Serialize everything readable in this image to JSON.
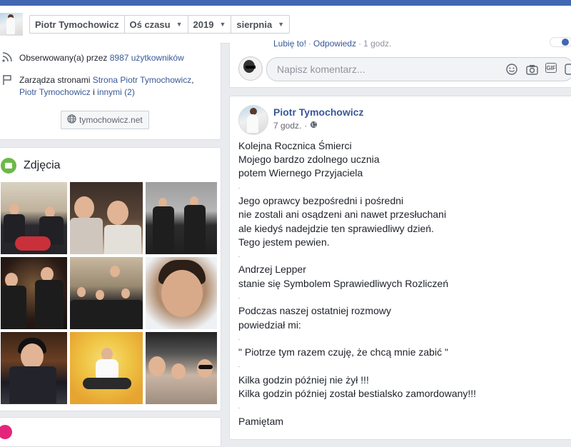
{
  "header": {
    "crumbs": [
      {
        "label": "Piotr Tymochowicz",
        "has_caret": false
      },
      {
        "label": "Oś czasu"
      },
      {
        "label": "2019"
      },
      {
        "label": "sierpnia"
      }
    ]
  },
  "intro": {
    "followers_prefix": "Obserwowany(a) przez ",
    "followers_link": "8987 użytkowników",
    "manages_prefix": "Zarządza stronami ",
    "manages_link1": "Strona Piotr Tymochowicz",
    "manages_comma": ",",
    "manages_link2": "Piotr Tymochowicz",
    "manages_and": " i ",
    "manages_link3": "innymi (2)",
    "website": "tymochowicz.net"
  },
  "photos": {
    "title": "Zdjęcia"
  },
  "comment": {
    "like": "Lubię to!",
    "reply": "Odpowiedz",
    "sep": "·",
    "time": "1 godz.",
    "placeholder": "Napisz komentarz...",
    "gif_label": "GIF"
  },
  "post": {
    "author": "Piotr Tymochowicz",
    "time": "7 godz.",
    "dot": "·",
    "lines": [
      {
        "text": "Kolejna Rocznica Śmierci"
      },
      {
        "text": "Mojego bardzo zdolnego ucznia"
      },
      {
        "text": "potem Wiernego Przyjaciela"
      },
      {
        "text": ".",
        "small": true
      },
      {
        "text": "Jego oprawcy bezpośredni i pośredni"
      },
      {
        "text": "nie zostali ani osądzeni ani nawet przesłuchani"
      },
      {
        "text": "ale kiedyś nadejdzie ten sprawiedliwy dzień."
      },
      {
        "text": "Tego jestem pewien."
      },
      {
        "text": ".",
        "small": true
      },
      {
        "text": "Andrzej Lepper"
      },
      {
        "text": "stanie się Symbolem Sprawiedliwych Rozliczeń"
      },
      {
        "text": ".",
        "small": true
      },
      {
        "text": "Podczas naszej ostatniej rozmowy"
      },
      {
        "text": "powiedział mi:"
      },
      {
        "text": ".",
        "small": true
      },
      {
        "text": "\" Piotrze tym razem czuję, że chcą mnie zabić \""
      },
      {
        "text": ".",
        "small": true
      },
      {
        "text": "Kilka godzin później nie żył !!!"
      },
      {
        "text": "Kilka godzin później został bestialsko zamordowany!!!"
      },
      {
        "text": ".",
        "small": true
      },
      {
        "text": "Pamiętam"
      }
    ]
  },
  "colors": {
    "brand": "#4267b2",
    "link": "#385898",
    "photos_icon": "#6cb947"
  }
}
